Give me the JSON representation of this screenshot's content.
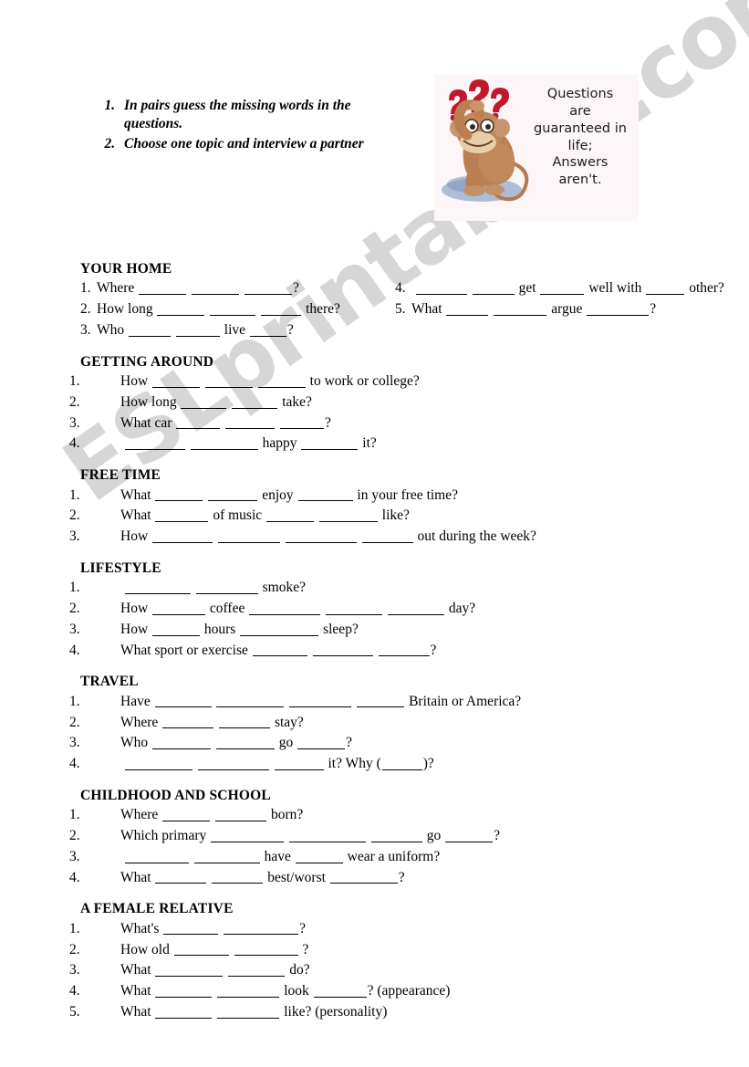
{
  "watermark": {
    "text": "ESLprintables.com"
  },
  "instructions": {
    "items": [
      "In pairs guess the missing words in the questions.",
      "Choose one topic and interview a partner"
    ]
  },
  "clipart": {
    "alt_name": "thinking-monkey-clipart",
    "caption_lines": [
      "Questions",
      "are",
      "guaranteed in",
      "life;",
      "Answers",
      "aren't."
    ],
    "question_mark_color": "#c0192e",
    "monkey_color": "#c08255",
    "shadow_color": "#8fa8c8",
    "background_color": "#fdf6f8"
  },
  "sections": [
    {
      "title": "YOUR HOME",
      "layout": "two-column-flat",
      "left_items": [
        {
          "num": "1.",
          "parts": [
            "Where ",
            {
              "blank": 52
            },
            " ",
            {
              "blank": 52
            },
            " ",
            {
              "blank": 52
            },
            "?"
          ]
        },
        {
          "num": "2.",
          "parts": [
            "How long ",
            {
              "blank": 52
            },
            " ",
            {
              "blank": 50
            },
            " ",
            {
              "blank": 44
            },
            " there?"
          ]
        },
        {
          "num": "3.",
          "parts": [
            "Who ",
            {
              "blank": 46
            },
            " ",
            {
              "blank": 48
            },
            " live ",
            {
              "blank": 40
            },
            "?"
          ]
        }
      ],
      "right_items": [
        {
          "num": "4.",
          "parts": [
            " ",
            {
              "blank": 56
            },
            " ",
            {
              "blank": 46
            },
            " get ",
            {
              "blank": 48
            },
            " well with ",
            {
              "blank": 42
            },
            " other?"
          ]
        },
        {
          "num": "5.",
          "parts": [
            "What ",
            {
              "blank": 46
            },
            " ",
            {
              "blank": 58
            },
            " argue ",
            {
              "blank": 68
            },
            "?"
          ]
        }
      ]
    },
    {
      "title": "GETTING AROUND",
      "layout": "indented",
      "items": [
        {
          "num": "1.",
          "parts": [
            "How ",
            {
              "blank": 52
            },
            " ",
            {
              "blank": 52
            },
            " ",
            {
              "blank": 52
            },
            " to work or college?"
          ]
        },
        {
          "num": "2.",
          "parts": [
            "How long ",
            {
              "blank": 50
            },
            " ",
            {
              "blank": 50
            },
            " take?"
          ]
        },
        {
          "num": "3.",
          "parts": [
            "What car ",
            {
              "blank": 48
            },
            " ",
            {
              "blank": 54
            },
            " ",
            {
              "blank": 48
            },
            "?"
          ]
        },
        {
          "num": "4.",
          "parts": [
            " ",
            {
              "blank": 66
            },
            " ",
            {
              "blank": 74
            },
            " happy ",
            {
              "blank": 62
            },
            " it?"
          ]
        }
      ]
    },
    {
      "title": "FREE TIME",
      "layout": "indented",
      "items": [
        {
          "num": "1.",
          "parts": [
            "What ",
            {
              "blank": 52
            },
            " ",
            {
              "blank": 54
            },
            " enjoy ",
            {
              "blank": 60
            },
            " in your free time?"
          ]
        },
        {
          "num": "2.",
          "parts": [
            "What ",
            {
              "blank": 58
            },
            " of music ",
            {
              "blank": 52
            },
            " ",
            {
              "blank": 64
            },
            " like?"
          ]
        },
        {
          "num": "3.",
          "parts": [
            "How ",
            {
              "blank": 66
            },
            " ",
            {
              "blank": 68
            },
            " ",
            {
              "blank": 78
            },
            " ",
            {
              "blank": 56
            },
            " out during the week?"
          ]
        }
      ]
    },
    {
      "title": "LIFESTYLE",
      "layout": "indented",
      "items": [
        {
          "num": "1.",
          "parts": [
            " ",
            {
              "blank": 72
            },
            " ",
            {
              "blank": 68
            },
            " smoke?"
          ]
        },
        {
          "num": "2.",
          "parts": [
            "How ",
            {
              "blank": 58
            },
            " coffee ",
            {
              "blank": 78
            },
            " ",
            {
              "blank": 62
            },
            " ",
            {
              "blank": 62
            },
            " day?"
          ]
        },
        {
          "num": "3.",
          "parts": [
            "How ",
            {
              "blank": 52
            },
            " hours ",
            {
              "blank": 86
            },
            " sleep?"
          ]
        },
        {
          "num": "4.",
          "parts": [
            "What sport or exercise ",
            {
              "blank": 60
            },
            " ",
            {
              "blank": 66
            },
            " ",
            {
              "blank": 56
            },
            "?"
          ]
        }
      ]
    },
    {
      "title": "TRAVEL",
      "layout": "indented",
      "items": [
        {
          "num": "1.",
          "parts": [
            "Have ",
            {
              "blank": 62
            },
            " ",
            {
              "blank": 74
            },
            " ",
            {
              "blank": 68
            },
            " ",
            {
              "blank": 52
            },
            " Britain or America?"
          ]
        },
        {
          "num": "2.",
          "parts": [
            "Where ",
            {
              "blank": 56
            },
            " ",
            {
              "blank": 56
            },
            " stay?"
          ]
        },
        {
          "num": "3.",
          "parts": [
            "Who ",
            {
              "blank": 64
            },
            " ",
            {
              "blank": 64
            },
            " go ",
            {
              "blank": 52
            },
            "?"
          ]
        },
        {
          "num": "4.",
          "parts": [
            " ",
            {
              "blank": 74
            },
            " ",
            {
              "blank": 78
            },
            " ",
            {
              "blank": 54
            },
            " it? Why (",
            {
              "blank": 44
            },
            ")?"
          ]
        }
      ]
    },
    {
      "title": "CHILDHOOD AND SCHOOL",
      "layout": "indented",
      "items": [
        {
          "num": "1.",
          "parts": [
            "Where ",
            {
              "blank": 52
            },
            " ",
            {
              "blank": 56
            },
            " born?"
          ]
        },
        {
          "num": "2.",
          "parts": [
            "Which primary ",
            {
              "blank": 80
            },
            " ",
            {
              "blank": 84
            },
            " ",
            {
              "blank": 56
            },
            " go ",
            {
              "blank": 52
            },
            "?"
          ]
        },
        {
          "num": "3.",
          "parts": [
            " ",
            {
              "blank": 70
            },
            " ",
            {
              "blank": 72
            },
            " have ",
            {
              "blank": 52
            },
            " wear a uniform?"
          ]
        },
        {
          "num": "4.",
          "parts": [
            "What ",
            {
              "blank": 56
            },
            " ",
            {
              "blank": 56
            },
            " best/worst ",
            {
              "blank": 74
            },
            "?"
          ]
        }
      ]
    },
    {
      "title": "A FEMALE RELATIVE",
      "layout": "indented",
      "items": [
        {
          "num": "1.",
          "parts": [
            "What's ",
            {
              "blank": 60
            },
            " ",
            {
              "blank": 82
            },
            "?"
          ]
        },
        {
          "num": "2.",
          "parts": [
            "How old ",
            {
              "blank": 60
            },
            " ",
            {
              "blank": 70
            },
            " ?"
          ]
        },
        {
          "num": "3.",
          "parts": [
            "What ",
            {
              "blank": 74
            },
            " ",
            {
              "blank": 62
            },
            " do?"
          ]
        },
        {
          "num": "4.",
          "parts": [
            "What ",
            {
              "blank": 62
            },
            " ",
            {
              "blank": 68
            },
            " look ",
            {
              "blank": 58
            },
            "? (appearance)"
          ]
        },
        {
          "num": "5.",
          "parts": [
            "What ",
            {
              "blank": 62
            },
            " ",
            {
              "blank": 68
            },
            " like? (personality)"
          ]
        }
      ]
    }
  ]
}
